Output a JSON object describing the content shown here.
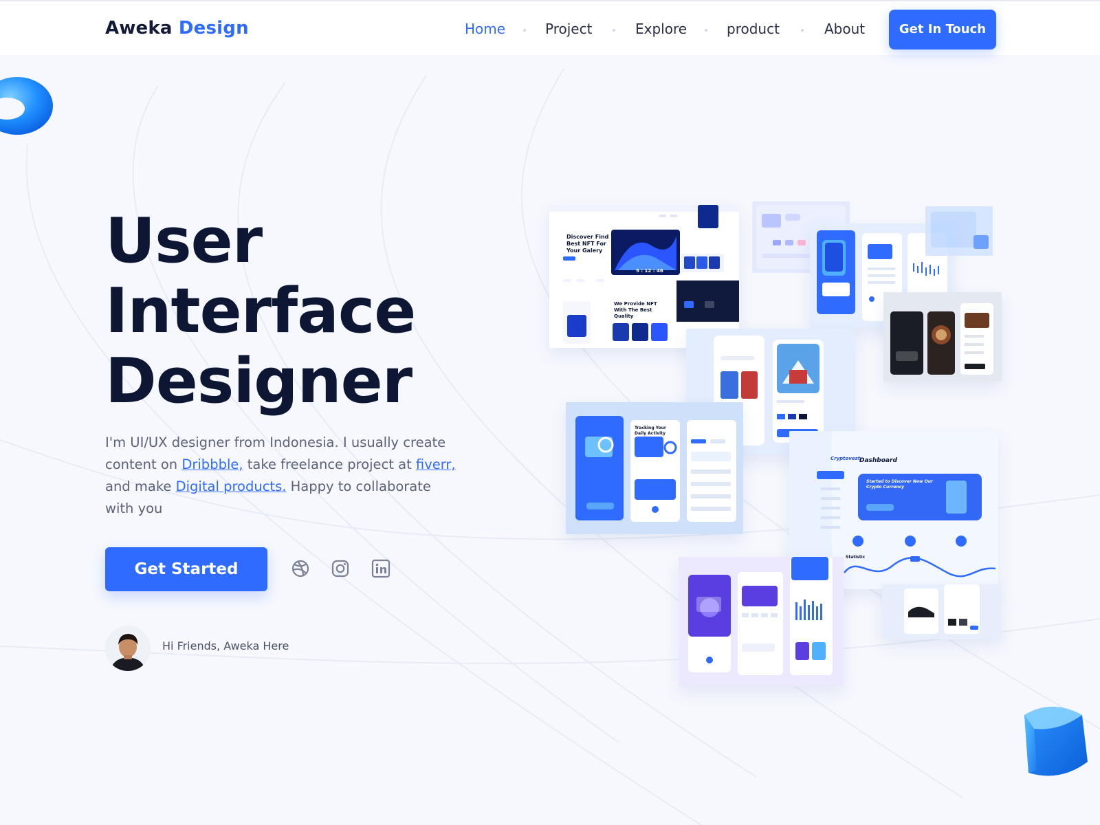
{
  "brand": {
    "part1": "Aweka",
    "part2": "Design"
  },
  "nav": {
    "items": [
      {
        "label": "Home",
        "active": true
      },
      {
        "label": "Project",
        "active": false
      },
      {
        "label": "Explore",
        "active": false
      },
      {
        "label": "product",
        "active": false
      },
      {
        "label": "About",
        "active": false
      }
    ],
    "cta_label": "Get In Touch"
  },
  "hero": {
    "title_lines": [
      "User",
      "Interface",
      "Designer"
    ],
    "desc_before": "I'm UI/UX designer from Indonesia. I usually create content on ",
    "link_dribbble": "Dribbble,",
    "desc_mid1": " take freelance project at ",
    "link_fiverr": "fiverr,",
    "desc_mid2": " and make ",
    "link_digital": "Digital products.",
    "desc_after": " Happy to collaborate with you",
    "button_label": "Get Started"
  },
  "social": [
    "dribbble-icon",
    "instagram-icon",
    "linkedin-icon"
  ],
  "profile": {
    "greeting": "Hi Friends, Aweka Here"
  },
  "collage": {
    "nft_title": "Discover Find Best NFT For Your Galery",
    "nft_sub": "We Provide NFT With The Best Quality",
    "tracking_title": "Tracking Your Daily Activity",
    "crypto_title": "Started to Discover New Our Crypto Currency",
    "dashboard_title": "Dashboard",
    "brand_crypto": "Cryptovest",
    "statistic": "Statistic",
    "timer": "5 : 12 : 46"
  },
  "colors": {
    "accent": "#2f6bff",
    "dark": "#0d1633",
    "background": "#f6f8fd"
  }
}
